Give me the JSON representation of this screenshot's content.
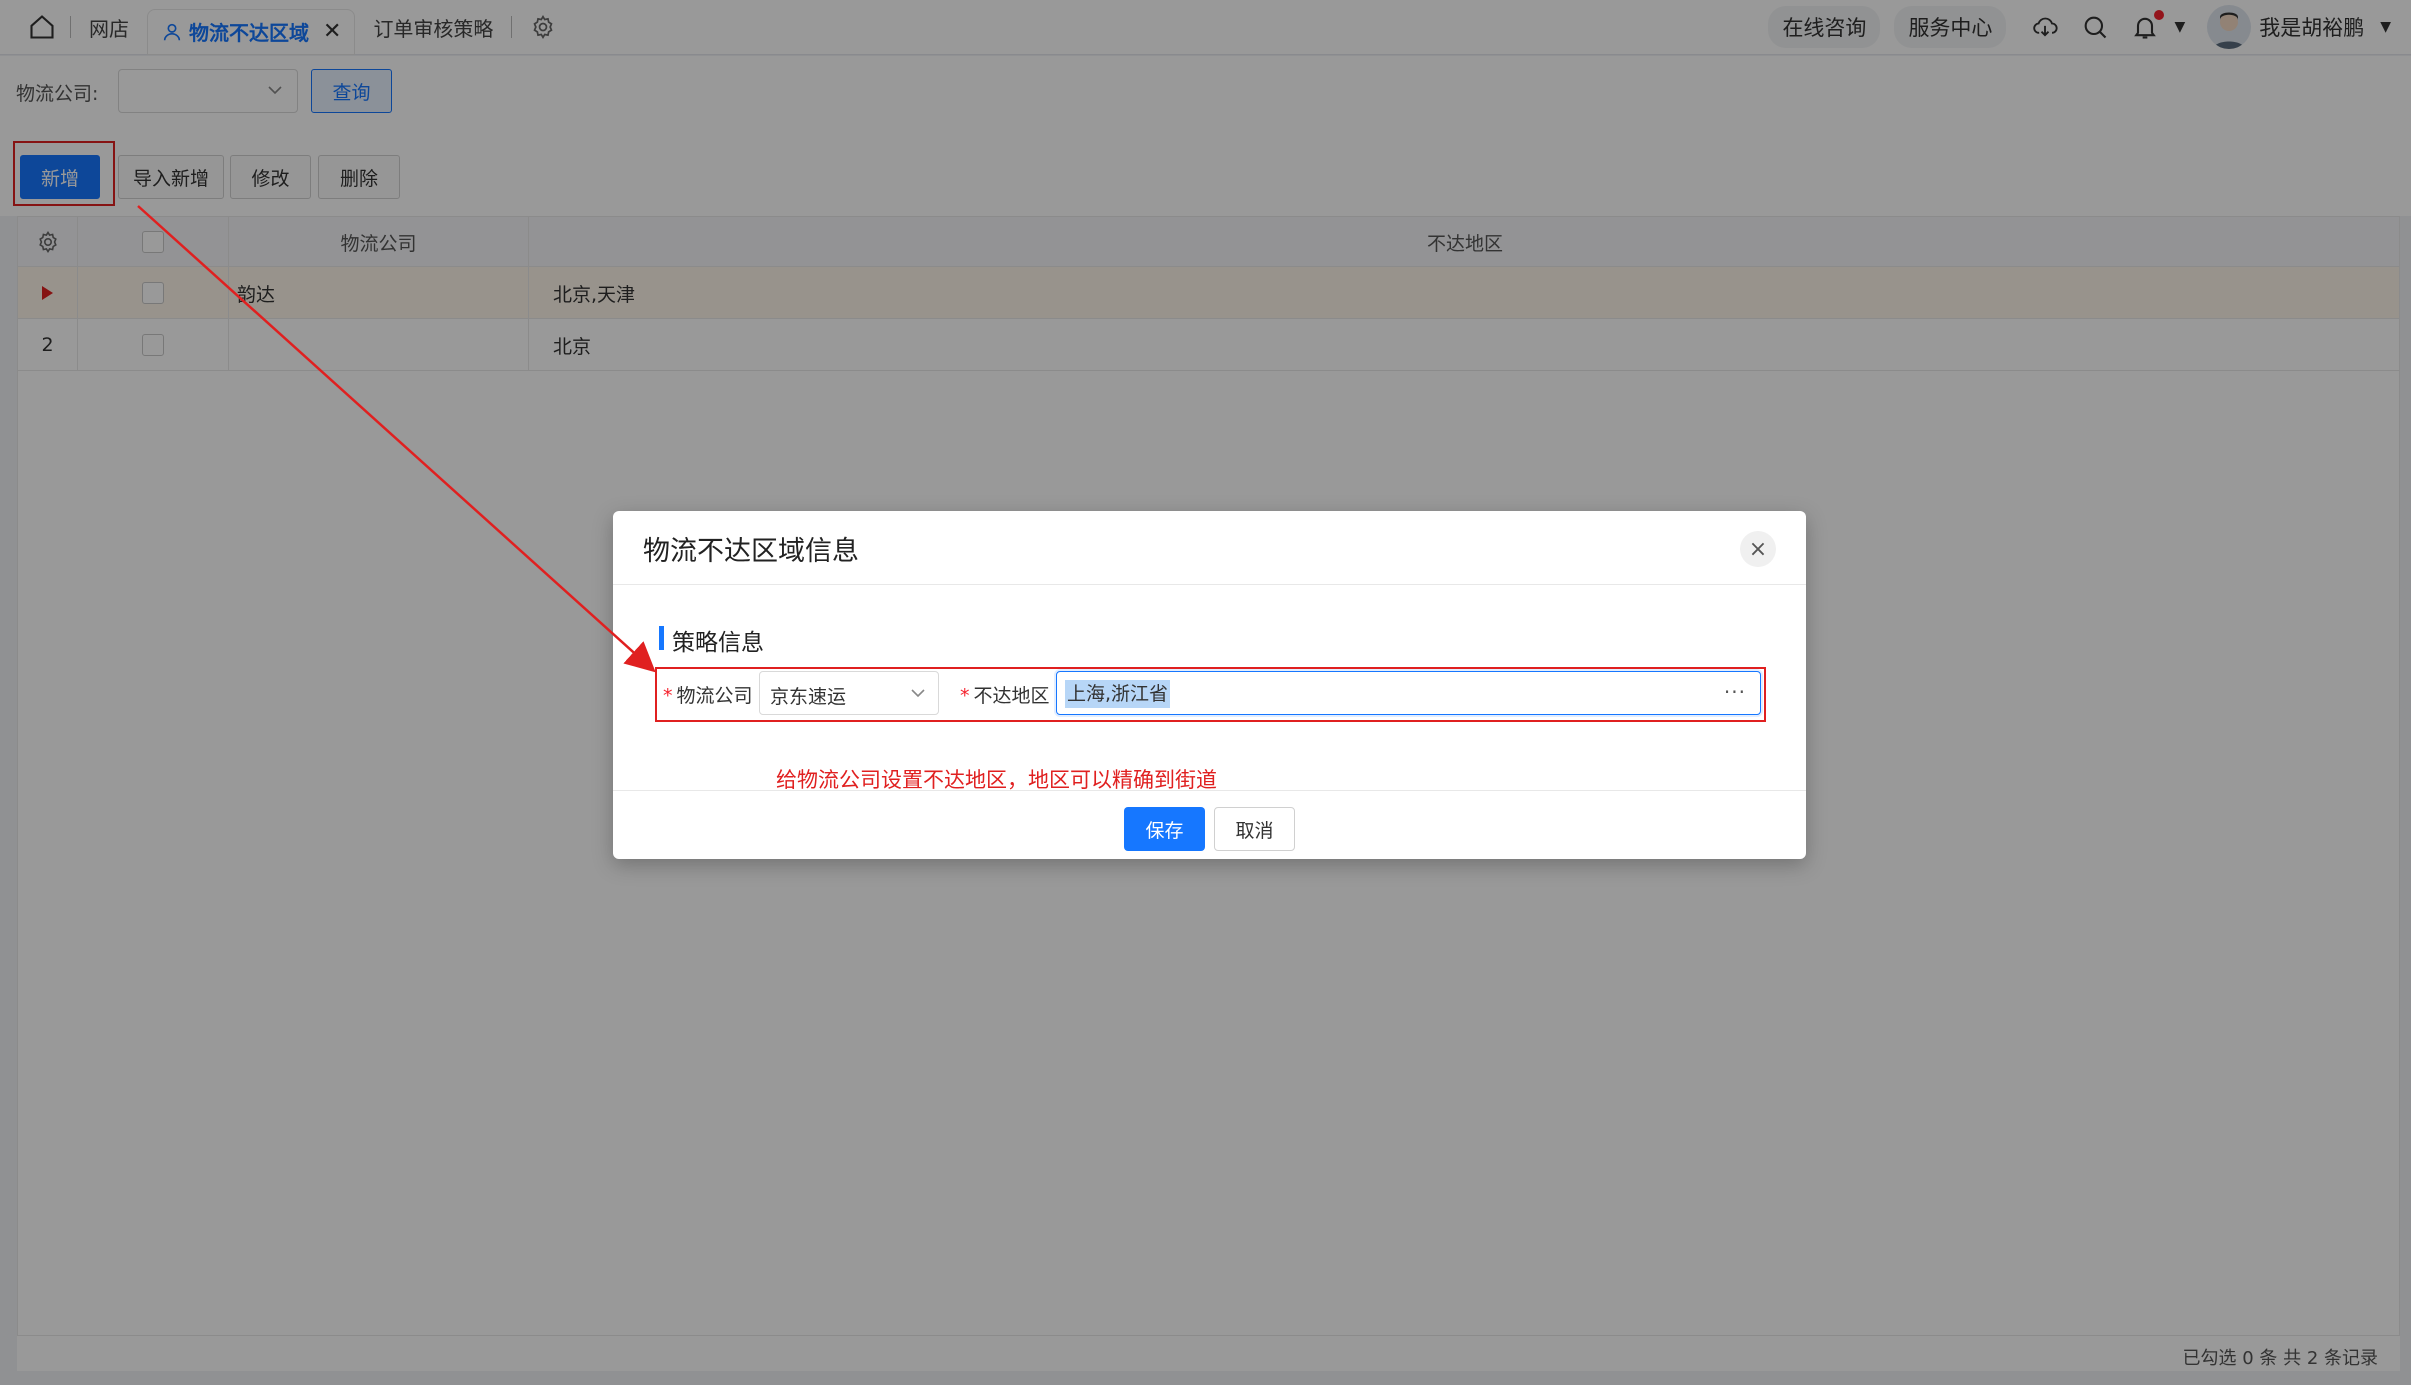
{
  "tabs": {
    "home_icon": "home-icon",
    "items": [
      {
        "label": "网店"
      },
      {
        "label": "物流不达区域",
        "active": true
      },
      {
        "label": "订单审核策略"
      }
    ],
    "close_glyph": "✕"
  },
  "header_right": {
    "consult": "在线咨询",
    "service": "服务中心",
    "username": "我是胡裕鹏"
  },
  "filter": {
    "label": "物流公司:",
    "select_value": "",
    "query_label": "查询"
  },
  "toolbar": {
    "add": "新增",
    "import_add": "导入新增",
    "edit": "修改",
    "delete": "删除"
  },
  "table": {
    "columns": [
      "物流公司",
      "不达地区"
    ],
    "rows": [
      {
        "index": "",
        "company": "韵达",
        "region": "北京,天津",
        "current": true
      },
      {
        "index": "2",
        "company": "",
        "region": "北京",
        "current": false
      }
    ],
    "footer": "已勾选 0 条 共 2 条记录"
  },
  "dialog": {
    "title": "物流不达区域信息",
    "close_glyph": "×",
    "section": "策略信息",
    "star": "*",
    "company_label": "物流公司",
    "company_value": "京东速运",
    "region_label": "不达地区",
    "region_value": "上海,浙江省",
    "more_glyph": "···",
    "annotation": "给物流公司设置不达地区，地区可以精确到街道",
    "save": "保存",
    "cancel": "取消"
  },
  "colors": {
    "primary": "#1677ff",
    "annotation_red": "#e02020"
  }
}
